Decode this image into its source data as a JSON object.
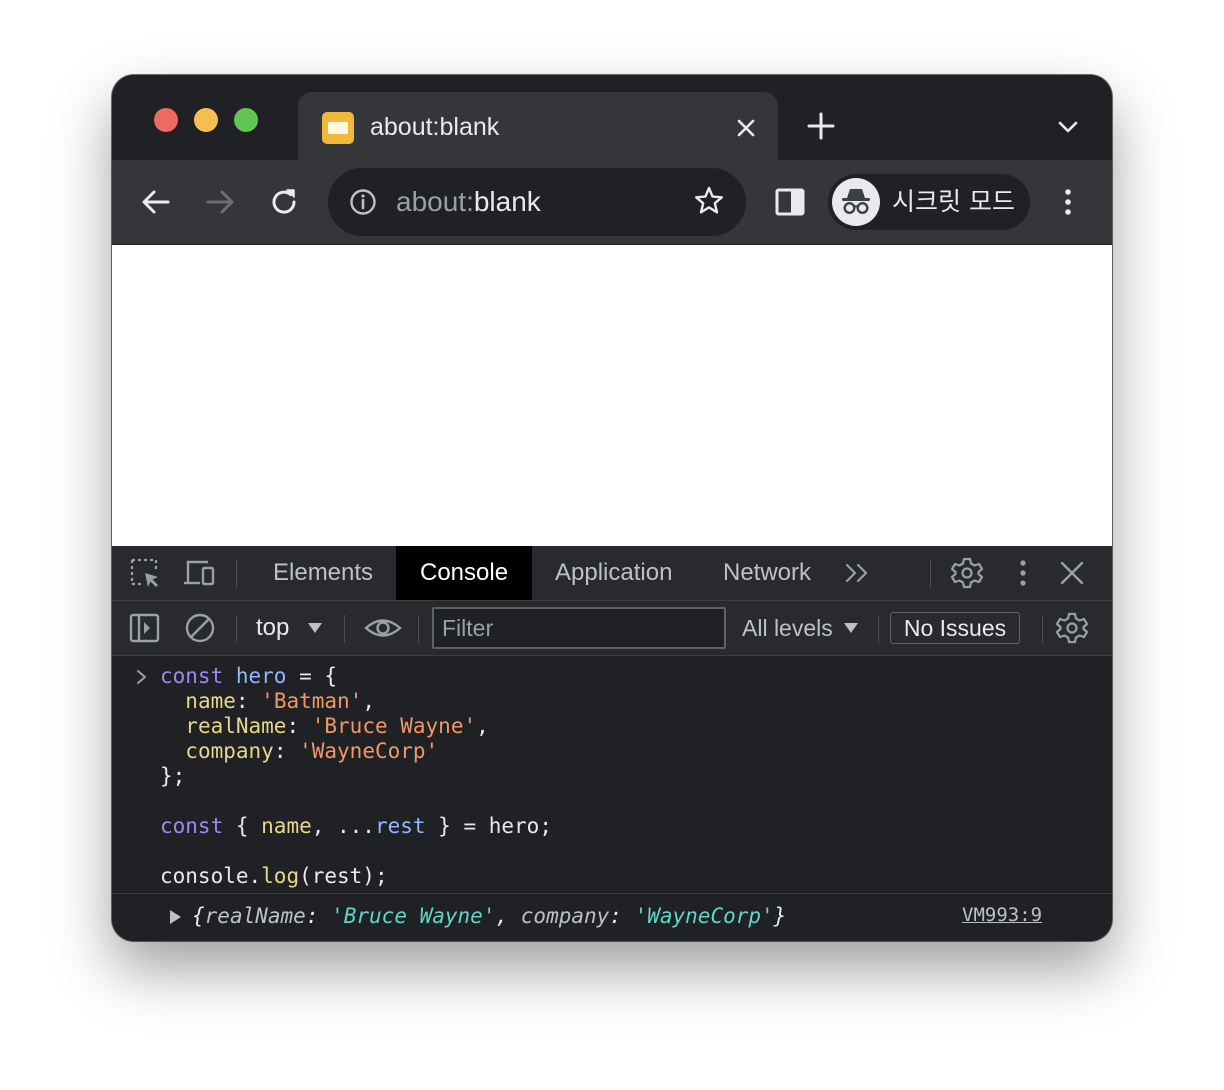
{
  "tab": {
    "title": "about:blank"
  },
  "toolbar": {
    "url_scheme": "about:",
    "url_path": "blank",
    "incognito_label": "시크릿 모드"
  },
  "devtools": {
    "tabs": [
      "Elements",
      "Console",
      "Application",
      "Network"
    ],
    "active_tab": "Console",
    "context": "top",
    "filter_placeholder": "Filter",
    "levels_label": "All levels",
    "issues_label": "No Issues"
  },
  "console": {
    "input_lines": [
      "const hero = {",
      "  name: 'Batman',",
      "  realName: 'Bruce Wayne',",
      "  company: 'WayneCorp'",
      "};",
      "",
      "const { name, ...rest } = hero;",
      "",
      "console.log(rest);"
    ],
    "output": {
      "key1": "realName",
      "val1": "'Bruce Wayne'",
      "key2": "company",
      "val2": "'WayneCorp'",
      "source": "VM993:9"
    }
  },
  "colors": {
    "keyword": "#9e89f2",
    "variable": "#8fb8ff",
    "property": "#e6d78a",
    "string": "#f29766",
    "output_string": "#5fd6c8"
  }
}
